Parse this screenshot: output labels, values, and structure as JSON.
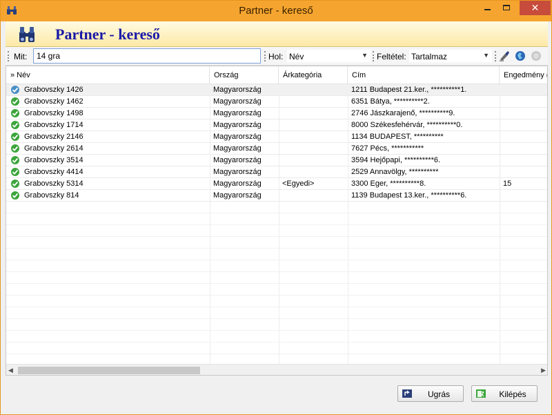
{
  "window": {
    "title": "Partner - kereső"
  },
  "header": {
    "title": "Partner - kereső"
  },
  "toolbar": {
    "search_label": "Mit:",
    "search_value": "14 gra",
    "where_label": "Hol:",
    "where_value": "Név",
    "condition_label": "Feltétel:",
    "condition_value": "Tartalmaz"
  },
  "table": {
    "columns": [
      "» Név",
      "Ország",
      "Árkategória",
      "Cím",
      "Engedmény (%)"
    ],
    "rows": [
      {
        "name": "Grabovszky  1426",
        "country": "Magyarország",
        "price": "",
        "address": "1211 Budapest 21.ker., **********1.",
        "discount": "",
        "status": "selected"
      },
      {
        "name": "Grabovszky  1462",
        "country": "Magyarország",
        "price": "",
        "address": "6351 Bátya, **********2.",
        "discount": "",
        "status": "ok"
      },
      {
        "name": "Grabovszky  1498",
        "country": "Magyarország",
        "price": "",
        "address": "2746 Jászkarajenő, **********9.",
        "discount": "",
        "status": "ok"
      },
      {
        "name": "Grabovszky  1714",
        "country": "Magyarország",
        "price": "",
        "address": "8000 Székesfehérvár, **********0.",
        "discount": "",
        "status": "ok"
      },
      {
        "name": "Grabovszky  2146",
        "country": "Magyarország",
        "price": "",
        "address": "1134 BUDAPEST, **********",
        "discount": "",
        "status": "ok"
      },
      {
        "name": "Grabovszky  2614",
        "country": "Magyarország",
        "price": "",
        "address": "7627 Pécs, ***********",
        "discount": "",
        "status": "ok"
      },
      {
        "name": "Grabovszky  3514",
        "country": "Magyarország",
        "price": "",
        "address": "3594 Hejőpapi, **********6.",
        "discount": "",
        "status": "ok"
      },
      {
        "name": "Grabovszky  4414",
        "country": "Magyarország",
        "price": "",
        "address": "2529 Annavölgy, **********",
        "discount": "",
        "status": "ok"
      },
      {
        "name": "Grabovszky  5314",
        "country": "Magyarország",
        "price": "<Egyedi>",
        "address": "3300 Eger, **********8.",
        "discount": "15",
        "status": "ok"
      },
      {
        "name": "Grabovszky  814",
        "country": "Magyarország",
        "price": "",
        "address": "1139 Budapest 13.ker., **********6.",
        "discount": "",
        "status": "ok"
      }
    ]
  },
  "footer": {
    "jump_label": "Ugrás",
    "exit_label": "Kilépés"
  },
  "colors": {
    "titlebar": "#f5a52f",
    "header_title": "#1a1aa8",
    "close_button": "#c74c3c",
    "check_green": "#3ca53c",
    "check_blue": "#4a90c8"
  },
  "icons": {
    "app": "binoculars-icon",
    "status_ok": "green-check-icon",
    "status_selected": "blue-check-icon",
    "jump": "arrow-jump-icon",
    "exit": "exit-door-icon"
  }
}
